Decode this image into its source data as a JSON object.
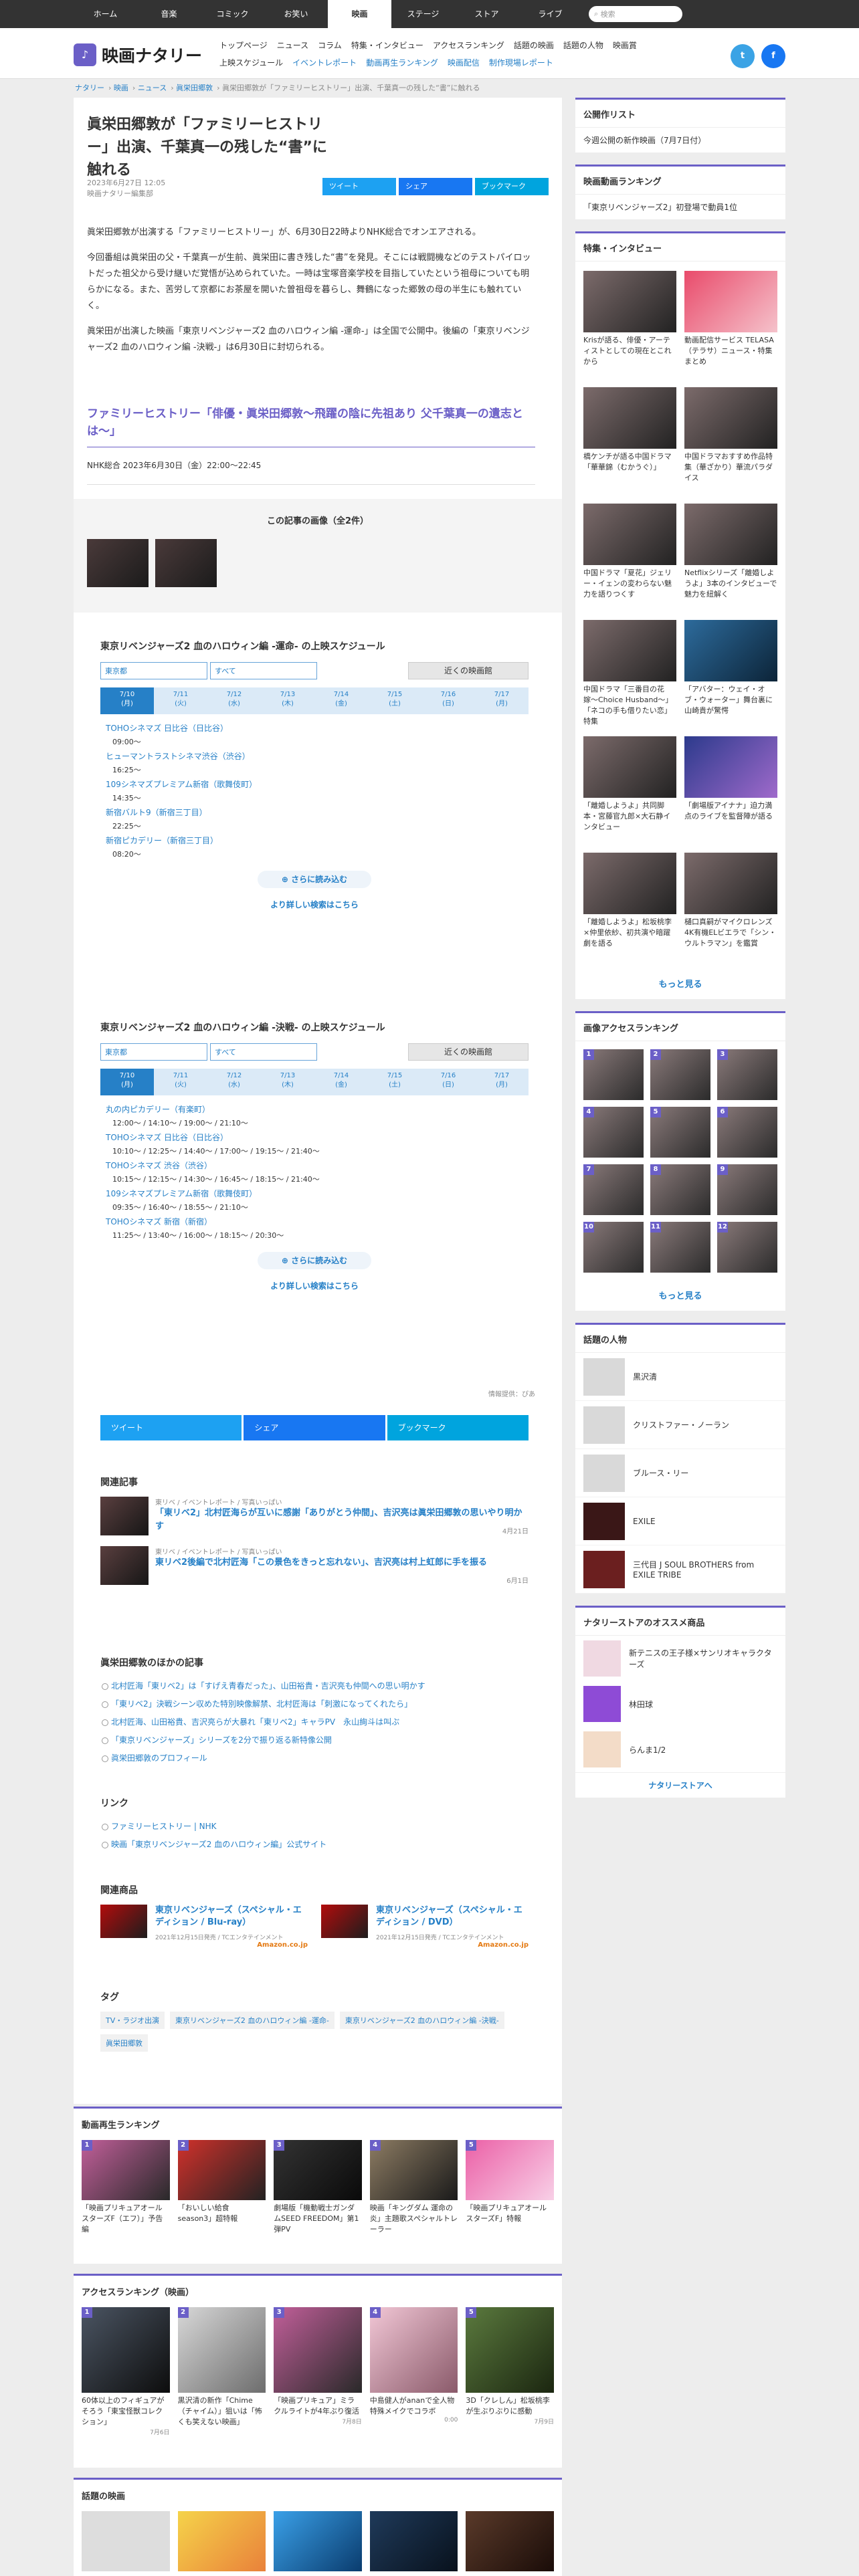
{
  "topnav": {
    "items": [
      "ホーム",
      "音楽",
      "コミック",
      "お笑い",
      "映画",
      "ステージ",
      "ストア",
      "ライブ"
    ],
    "active": 4,
    "search_placeholder": "検索"
  },
  "header": {
    "logo_text": "映画ナタリー",
    "nav_row1": [
      "トップページ",
      "ニュース",
      "コラム",
      "特集・インタビュー",
      "アクセスランキング",
      "話題の映画",
      "話題の人物",
      "映画賞"
    ],
    "nav_row2": [
      "上映スケジュール",
      "イベントレポート",
      "動画再生ランキング",
      "映画配信",
      "制作現場レポート"
    ]
  },
  "breadcrumb": [
    "ナタリー",
    "映画",
    "ニュース",
    "眞栄田郷敦",
    "眞栄田郷敦が「ファミリーヒストリー」出演、千葉真一の残した“書”に触れる"
  ],
  "article": {
    "title": "眞栄田郷敦が「ファミリーヒストリー」出演、千葉真一の残した“書”に触れる",
    "date": "2023年6月27日 12:05",
    "author": "映画ナタリー編集部",
    "share_tweet": "ツイート",
    "share_fb": "シェア",
    "share_hb": "ブックマーク",
    "p1": "眞栄田郷敦が出演する「ファミリーヒストリー」が、6月30日22時よりNHK総合でオンエアされる。",
    "p2": "今回番組は眞栄田の父・千葉真一が生前、眞栄田に書き残した“書”を発見。そこには戦闘機などのテストパイロットだった祖父から受け継いだ覚悟が込められていた。一時は宝塚音楽学校を目指していたという祖母についても明らかになる。また、苦労して京都にお茶屋を開いた曽祖母を暮らし、舞鶴になった郷敦の母の半生にも触れていく。",
    "p3": "眞栄田が出演した映画「東京リベンジャーズ2 血のハロウィン編 -運命-」は全国で公開中。後編の「東京リベンジャーズ2 血のハロウィン編 -決戦-」は6月30日に封切られる。",
    "program_title": "ファミリーヒストリー「俳優・眞栄田郷敦〜飛躍の陰に先祖あり 父千葉真一の遺志とは〜」",
    "program_info": "NHK総合 2023年6月30日（金）22:00〜22:45"
  },
  "images": {
    "title": "この記事の画像（全2件）"
  },
  "sched1": {
    "title": "東京リベンジャーズ2 血のハロウィン編 -運命- の上映スケジュール",
    "pref": "東京都",
    "area": "すべて",
    "near": "近くの映画館",
    "dates": [
      "7/10\n(月)",
      "7/11\n(火)",
      "7/12\n(水)",
      "7/13\n(木)",
      "7/14\n(金)",
      "7/15\n(土)",
      "7/16\n(日)",
      "7/17\n(月)"
    ],
    "theaters": [
      {
        "name": "TOHOシネマズ 日比谷（日比谷）",
        "times": "09:00〜"
      },
      {
        "name": "ヒューマントラストシネマ渋谷（渋谷）",
        "times": "16:25〜"
      },
      {
        "name": "109シネマズプレミアム新宿（歌舞伎町）",
        "times": "14:35〜"
      },
      {
        "name": "新宿バルト9（新宿三丁目）",
        "times": "22:25〜"
      },
      {
        "name": "新宿ピカデリー（新宿三丁目）",
        "times": "08:20〜"
      }
    ],
    "more": "さらに読み込む",
    "search": "より詳しい検索はこちら"
  },
  "sched2": {
    "title": "東京リベンジャーズ2 血のハロウィン編 -決戦- の上映スケジュール",
    "pref": "東京都",
    "area": "すべて",
    "near": "近くの映画館",
    "dates": [
      "7/10\n(月)",
      "7/11\n(火)",
      "7/12\n(水)",
      "7/13\n(木)",
      "7/14\n(金)",
      "7/15\n(土)",
      "7/16\n(日)",
      "7/17\n(月)"
    ],
    "theaters": [
      {
        "name": "丸の内ピカデリー（有楽町）",
        "times": "12:00〜 / 14:10〜 / 19:00〜 / 21:10〜"
      },
      {
        "name": "TOHOシネマズ 日比谷（日比谷）",
        "times": "10:10〜 / 12:25〜 / 14:40〜 / 17:00〜 / 19:15〜 / 21:40〜"
      },
      {
        "name": "TOHOシネマズ 渋谷（渋谷）",
        "times": "10:15〜 / 12:15〜 / 14:30〜 / 16:45〜 / 18:15〜 / 21:40〜"
      },
      {
        "name": "109シネマズプレミアム新宿（歌舞伎町）",
        "times": "09:35〜 / 16:40〜 / 18:55〜 / 21:10〜"
      },
      {
        "name": "TOHOシネマズ 新宿（新宿）",
        "times": "11:25〜 / 13:40〜 / 16:00〜 / 18:15〜 / 20:30〜"
      }
    ],
    "more": "さらに読み込む",
    "search": "より詳しい検索はこちら",
    "source": "情報提供：ぴあ"
  },
  "related": {
    "title": "関連記事",
    "items": [
      {
        "tags": "東リベ / イベントレポート / 写真いっぱい",
        "title": "「東リベ2」北村匠海らが互いに感謝「ありがとう仲間」、吉沢亮は眞栄田郷敦の思いやり明かす",
        "date": "4月21日"
      },
      {
        "tags": "東リベ / イベントレポート / 写真いっぱい",
        "title": "東リベ2後編で北村匠海「この景色をきっと忘れない」、吉沢亮は村上虹郎に手を振る",
        "date": "6月1日"
      }
    ]
  },
  "others": {
    "title": "眞栄田郷敦のほかの記事",
    "items": [
      "北村匠海「東リベ2」は「すげえ青春だった」、山田裕貴・吉沢亮も仲間への思い明かす",
      "「東リベ2」決戦シーン収めた特別映像解禁、北村匠海は「刺激になってくれたら」",
      "北村匠海、山田裕貴、吉沢亮らが大暴れ「東リベ2」キャラPV　永山絢斗は叫ぶ",
      "「東京リベンジャーズ」シリーズを2分で振り返る新特像公開",
      "眞栄田郷敦のプロフィール"
    ]
  },
  "links": {
    "title": "リンク",
    "items": [
      "ファミリーヒストリー | NHK",
      "映画「東京リベンジャーズ2 血のハロウィン編」公式サイト"
    ]
  },
  "products": {
    "title": "関連商品",
    "items": [
      {
        "title": "東京リベンジャーズ（スペシャル・エディション / Blu-ray）",
        "meta": "2021年12月15日発売 / TCエンタテインメント",
        "store": "Amazon.co.jp"
      },
      {
        "title": "東京リベンジャーズ（スペシャル・エディション / DVD）",
        "meta": "2021年12月15日発売 / TCエンタテインメント",
        "store": "Amazon.co.jp"
      }
    ]
  },
  "tags": {
    "title": "タグ",
    "items": [
      "TV・ラジオ出演",
      "東京リベンジャーズ2 血のハロウィン編 -運命-",
      "東京リベンジャーズ2 血のハロウィン編 -決戦-",
      "眞栄田郷敦"
    ]
  },
  "side": {
    "release_title": "公開作リスト",
    "release_item": "今週公開の新作映画（7月7日付）",
    "rank_title": "映画動画ランキング",
    "rank_item": "「東京リベンジャーズ2」初登場で動員1位",
    "feature_title": "特集・インタビュー",
    "feature_items": [
      "Krisが語る、俳優・アーティストとしての現在とこれから",
      "動画配信サービス TELASA（テラサ）ニュース・特集まとめ",
      "橋ケンチが語る中国ドラマ「華華錦（むかうぐ）」",
      "中国ドラマおすすめ作品特集（華ざかり）華流パラダイス",
      "中国ドラマ「夏花」ジェリー・イェンの変わらない魅力を語りつくす",
      "Netflixシリーズ「離婚しようよ」3本のインタビューで魅力を紐解く",
      "中国ドラマ「三番目の花嫁〜Choice Husband〜」「ネコの手も借りたい恋」特集",
      "「アバター：ウェイ・オブ・ウォーター」舞台裏に山崎貴が驚愕",
      "「離婚しようよ」共同脚本・宮藤官九郎×大石静インタビュー",
      "「劇場版アイナナ」迫力満点のライブを監督陣が語る",
      "「離婚しようよ」松坂桃李×仲里依紗、初共演や暗躍劇を語る",
      "樋口真嗣がマイクロレンズ4K有機ELビエラで「シン・ウルトラマン」を鑑賞"
    ],
    "more": "もっと見る",
    "imgrank_title": "画像アクセスランキング",
    "people_title": "話題の人物",
    "people": [
      "黒沢清",
      "クリストファー・ノーラン",
      "ブルース・リー",
      "EXILE",
      "三代目 J SOUL BROTHERS from EXILE TRIBE"
    ],
    "store_title": "ナタリーストアのオススメ商品",
    "store_items": [
      "新テニスの王子様×サンリオキャラクターズ",
      "林田球",
      "らんま1/2"
    ],
    "store_btn": "ナタリーストアへ"
  },
  "bottom": {
    "video_title": "動画再生ランキング",
    "video_items": [
      "「映画プリキュアオールスターズF（エフ）」予告編",
      "「おいしい給食 season3」超特報",
      "劇場版「機動戦士ガンダムSEED FREEDOM」第1弾PV",
      "映画「キングダム 運命の炎」主題歌スペシャルトレーラー",
      "「映画プリキュアオールスターズF」特報"
    ],
    "access_title": "アクセスランキング（映画）",
    "access_items": [
      {
        "t": "60体以上のフィギュアがそろう「東宝怪獣コレクション」",
        "d": "7月6日"
      },
      {
        "t": "黒沢清の新作「Chime（チャイム）」狙いは「怖くも笑えない映画」",
        "d": ""
      },
      {
        "t": "「映画プリキュア」ミラクルライトが4年ぶり復活",
        "d": "7月8日"
      },
      {
        "t": "中島健人がananで全人物特殊メイクでコラボ",
        "d": "0:00"
      },
      {
        "t": "3D「クレしん」松坂桃李が生ぶりぶりに感動",
        "d": "7月9日"
      }
    ],
    "topic_title": "話題の映画"
  }
}
